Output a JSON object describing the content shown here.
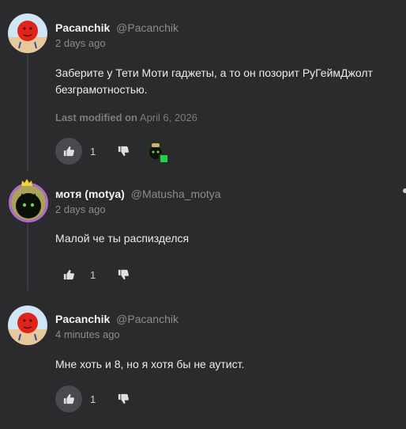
{
  "comments": [
    {
      "author": "Pacanchik",
      "handle": "@Pacanchik",
      "time": "2 days ago",
      "text": "Заберите у Тети Моти гаджеты, а то он позорит РуГеймДжолт безграмотностью.",
      "modified_label": "Last modified on",
      "modified_date": "April 6, 2026",
      "likes": "1",
      "liked": true
    },
    {
      "author": "мотя (motya)",
      "handle": "@Matusha_motya",
      "time": "2 days ago",
      "text": "Малой че ты распизделся",
      "likes": "1",
      "liked": false
    },
    {
      "author": "Pacanchik",
      "handle": "@Pacanchik",
      "time": "4 minutes ago",
      "text": "Мне хоть и 8, но я хотя бы не аутист.",
      "likes": "1",
      "liked": true
    }
  ],
  "icons": {
    "like": "thumbs-up-icon",
    "dislike": "thumbs-down-icon"
  },
  "colors": {
    "background": "#2b2a2d",
    "accent_green": "#22d146",
    "like_bg": "#4a494d"
  }
}
